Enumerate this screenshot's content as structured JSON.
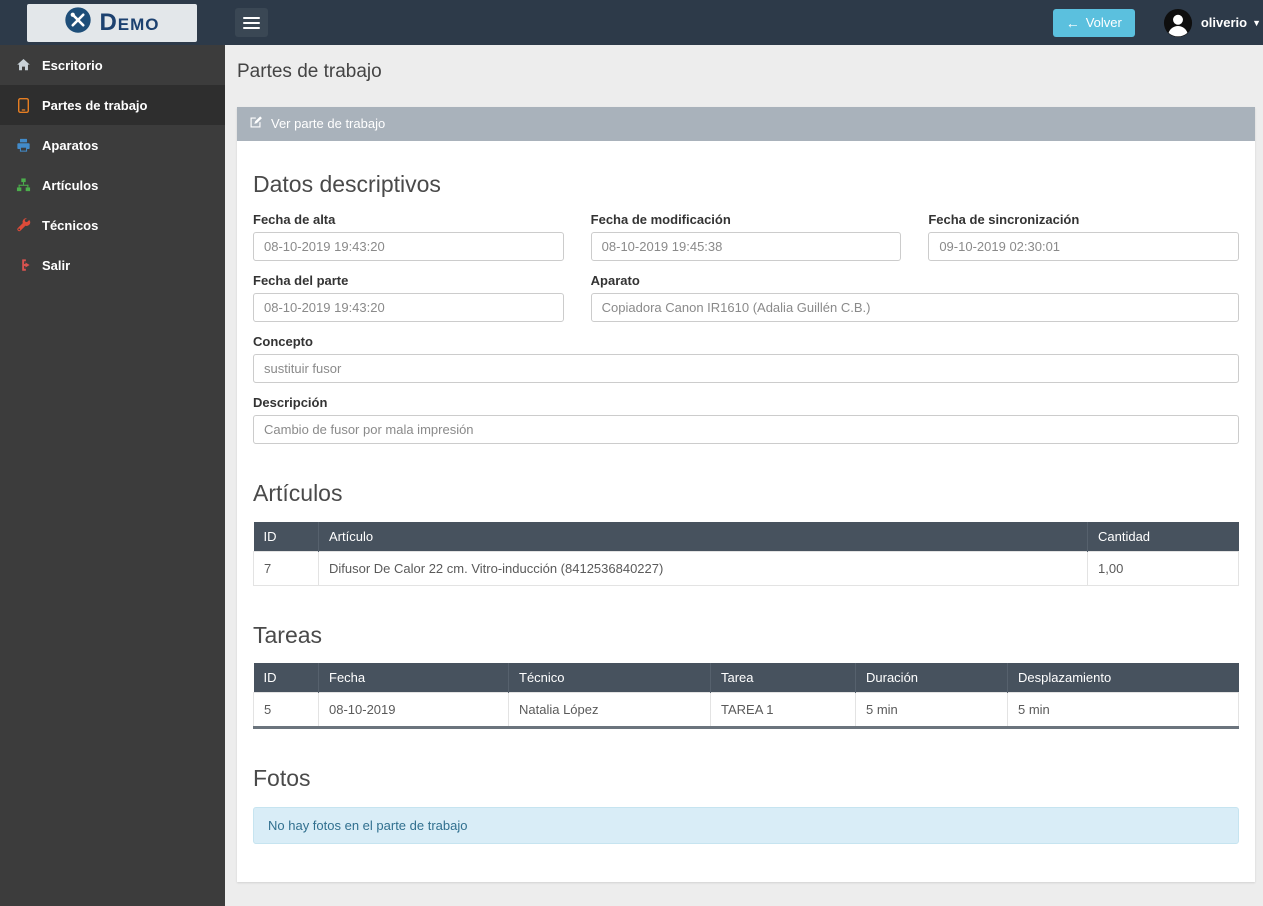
{
  "brand": {
    "logo_text": "Demo"
  },
  "topbar": {
    "back_button": "Volver",
    "username": "oliverio"
  },
  "sidebar": {
    "items": [
      {
        "label": "Escritorio",
        "icon": "home-icon"
      },
      {
        "label": "Partes de trabajo",
        "icon": "tablet-icon",
        "active": true
      },
      {
        "label": "Aparatos",
        "icon": "device-icon"
      },
      {
        "label": "Artículos",
        "icon": "sitemap-icon"
      },
      {
        "label": "Técnicos",
        "icon": "wrench-icon"
      },
      {
        "label": "Salir",
        "icon": "sign-out-icon"
      }
    ]
  },
  "page": {
    "title": "Partes de trabajo"
  },
  "panel": {
    "title": "Ver parte de trabajo"
  },
  "datos": {
    "title": "Datos descriptivos",
    "fields": [
      {
        "label": "Fecha de alta",
        "value": "08-10-2019 19:43:20"
      },
      {
        "label": "Fecha de modificación",
        "value": "08-10-2019 19:45:38"
      },
      {
        "label": "Fecha de sincronización",
        "value": "09-10-2019 02:30:01"
      },
      {
        "label": "Fecha del parte",
        "value": "08-10-2019 19:43:20"
      },
      {
        "label": "Aparato",
        "value": "Copiadora Canon IR1610 (Adalia Guillén C.B.)"
      },
      {
        "label": "Concepto",
        "value": "sustituir fusor"
      },
      {
        "label": "Descripción",
        "value": "Cambio de fusor por mala impresión"
      }
    ]
  },
  "articulos": {
    "title": "Artículos",
    "headers": [
      "ID",
      "Artículo",
      "Cantidad"
    ],
    "rows": [
      [
        "7",
        "Difusor De Calor 22 cm. Vitro-inducción (8412536840227)",
        "1,00"
      ]
    ]
  },
  "tareas": {
    "title": "Tareas",
    "headers": [
      "ID",
      "Fecha",
      "Técnico",
      "Tarea",
      "Duración",
      "Desplazamiento"
    ],
    "rows": [
      [
        "5",
        "08-10-2019",
        "Natalia López",
        "TAREA 1",
        "5 min",
        "5 min"
      ]
    ]
  },
  "fotos": {
    "title": "Fotos",
    "empty_message": "No hay fotos en el parte de trabajo"
  },
  "colors": {
    "topbar": "#2d3a49",
    "sidebar": "#3c3c3c",
    "accent_blue": "#5bc0de",
    "panel_header": "#a9b2bb",
    "table_header": "#47525e",
    "alert_bg": "#d9edf7",
    "alert_text": "#31708f"
  }
}
